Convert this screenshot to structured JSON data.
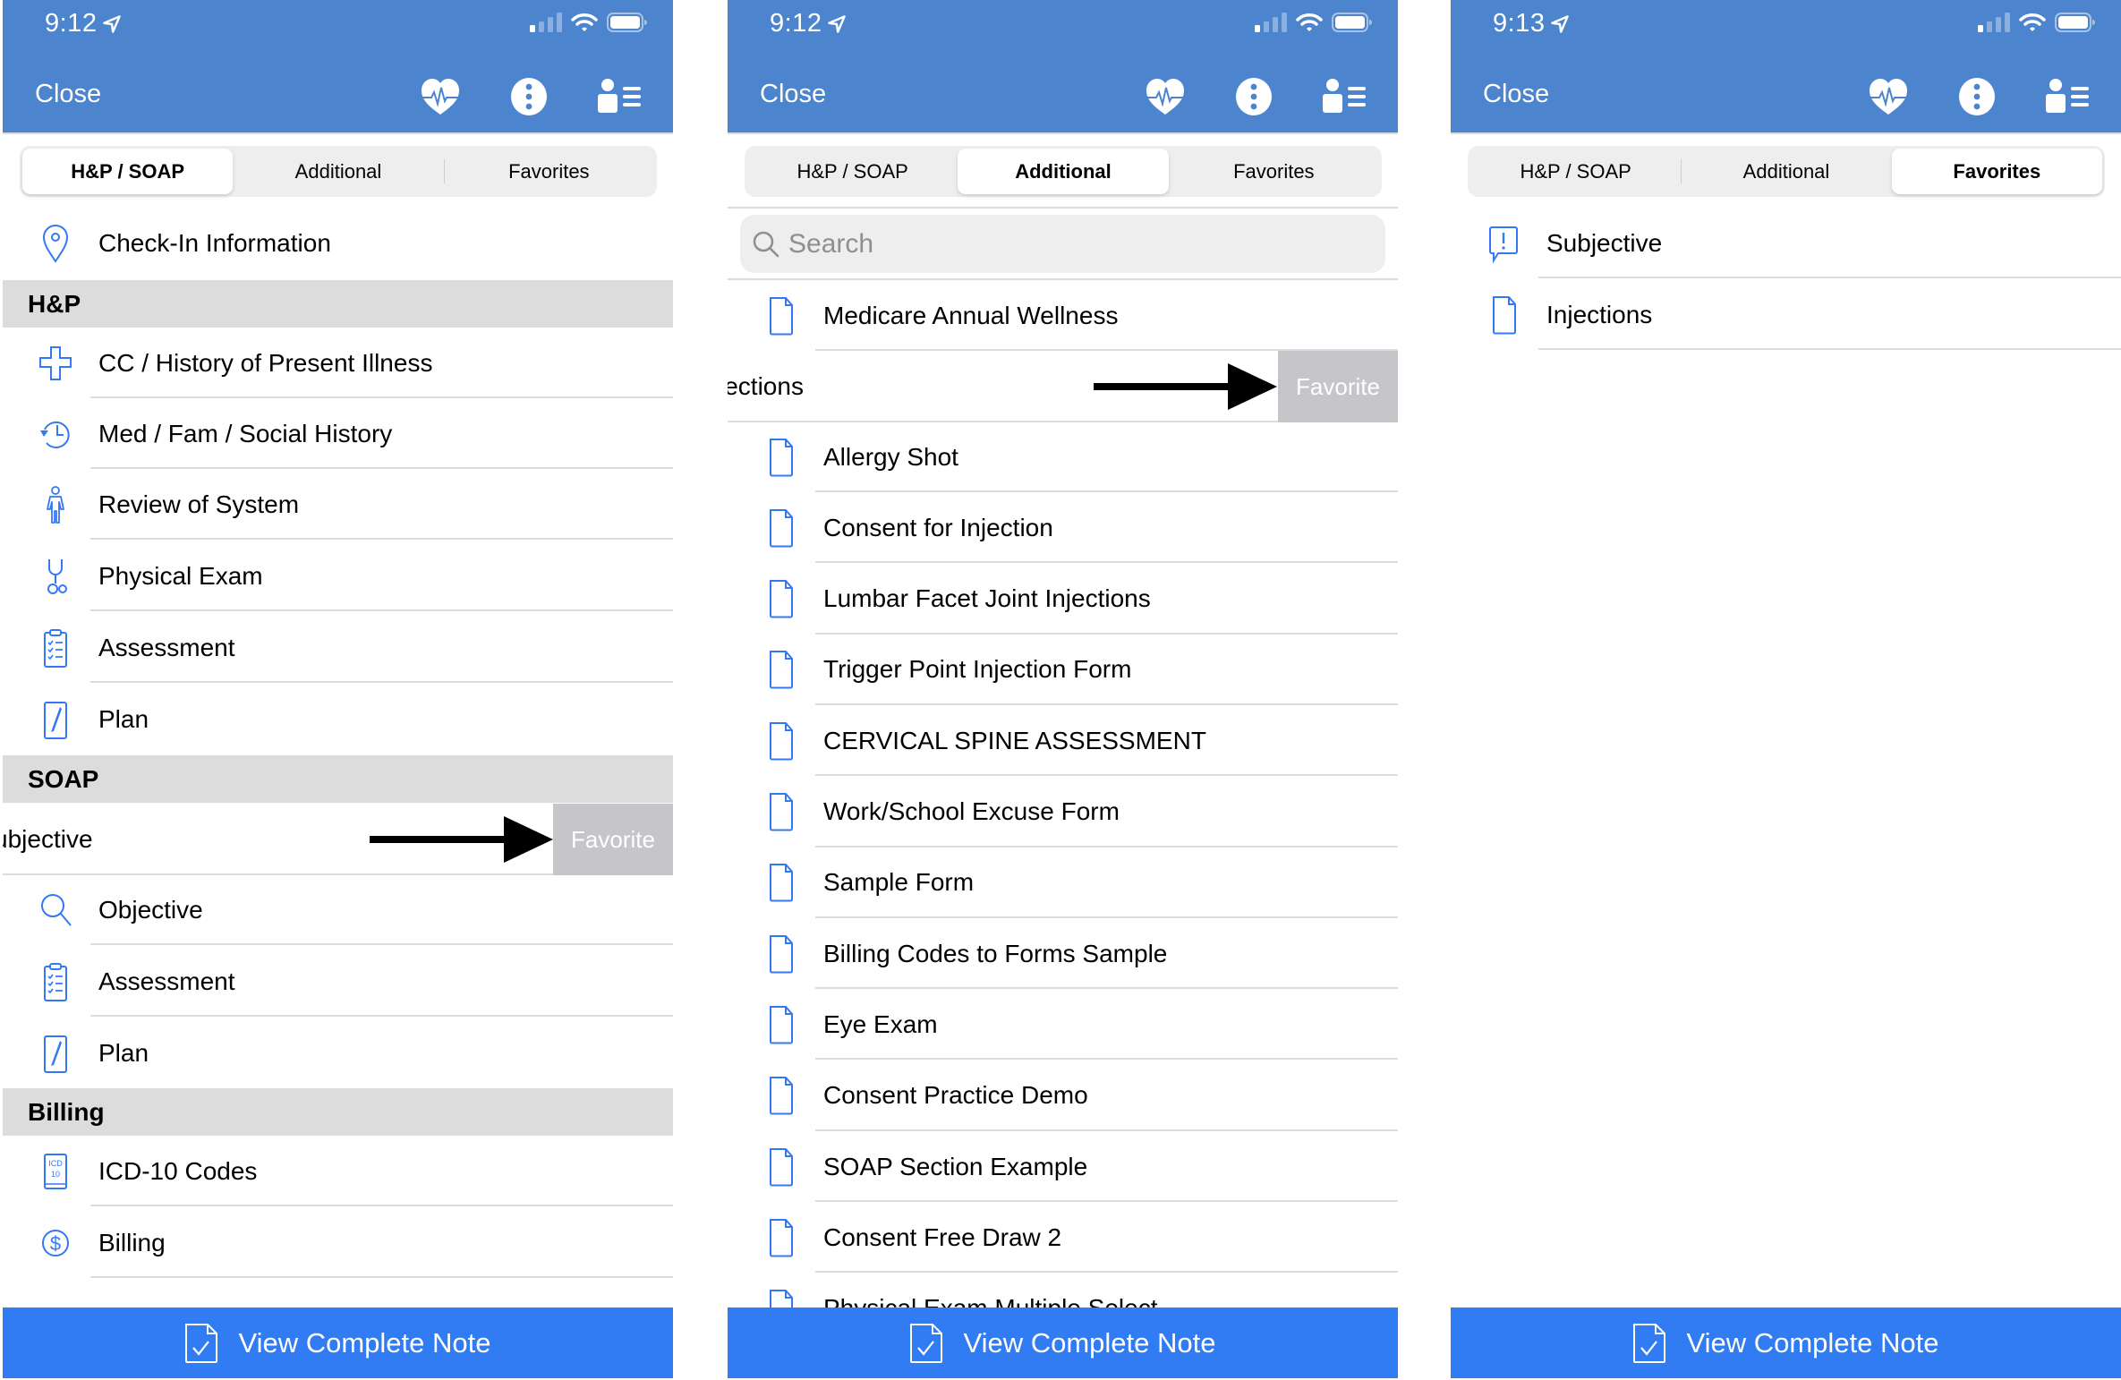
{
  "colors": {
    "header": "#4d84ce",
    "accent_button": "#317cf3",
    "icon_blue": "#3478f6",
    "section_bg": "#dcdcdc",
    "favorite_action_bg": "#c5c5ca"
  },
  "common": {
    "close_label": "Close",
    "header_icons": [
      "heart-pulse-icon",
      "more-vertical-icon",
      "patient-list-icon"
    ],
    "status_icons": [
      "signal-icon",
      "wifi-icon",
      "battery-icon"
    ],
    "signal_bars_filled": 1,
    "signal_bars_total": 4,
    "tabs": [
      "H&P / SOAP",
      "Additional",
      "Favorites"
    ],
    "view_complete_note_label": "View Complete Note",
    "favorite_action_label": "Favorite"
  },
  "panel1": {
    "time": "9:12",
    "active_tab": "H&P / SOAP",
    "top_item": {
      "label": "Check-In Information",
      "icon": "location-pin-icon"
    },
    "sections": [
      {
        "title": "H&P",
        "items": [
          {
            "label": "CC / History of Present Illness",
            "icon": "medical-cross-icon"
          },
          {
            "label": "Med / Fam / Social History",
            "icon": "history-clock-icon"
          },
          {
            "label": "Review of System",
            "icon": "body-figure-icon"
          },
          {
            "label": "Physical Exam",
            "icon": "stethoscope-icon"
          },
          {
            "label": "Assessment",
            "icon": "clipboard-checklist-icon"
          },
          {
            "label": "Plan",
            "icon": "pen-document-icon"
          }
        ]
      },
      {
        "title": "SOAP",
        "swiped_item": {
          "label": "Subjective",
          "visible_text": "ubjective"
        },
        "items": [
          {
            "label": "Objective",
            "icon": "magnifier-icon"
          },
          {
            "label": "Assessment",
            "icon": "clipboard-checklist-icon"
          },
          {
            "label": "Plan",
            "icon": "pen-document-icon"
          }
        ]
      },
      {
        "title": "Billing",
        "items": [
          {
            "label": "ICD-10 Codes",
            "icon": "icd10-book-icon"
          },
          {
            "label": "Billing",
            "icon": "dollar-circle-icon"
          }
        ]
      }
    ]
  },
  "panel2": {
    "time": "9:12",
    "active_tab": "Additional",
    "search_placeholder": "Search",
    "first_item": "Medicare Annual Wellness",
    "swiped_item": {
      "label": "Injections",
      "visible_text": "jections"
    },
    "items": [
      "Allergy Shot",
      "Consent for Injection",
      "Lumbar Facet Joint Injections",
      "Trigger Point Injection Form",
      "CERVICAL SPINE ASSESSMENT",
      "Work/School Excuse Form",
      "Sample Form",
      "Billing Codes to Forms Sample",
      "Eye Exam",
      "Consent Practice Demo",
      "SOAP Section Example",
      "Consent Free Draw 2",
      "Physical Exam Multiple Select"
    ]
  },
  "panel3": {
    "time": "9:13",
    "active_tab": "Favorites",
    "items": [
      {
        "label": "Subjective",
        "icon": "alert-speech-bubble-icon"
      },
      {
        "label": "Injections",
        "icon": "document-icon"
      }
    ]
  }
}
